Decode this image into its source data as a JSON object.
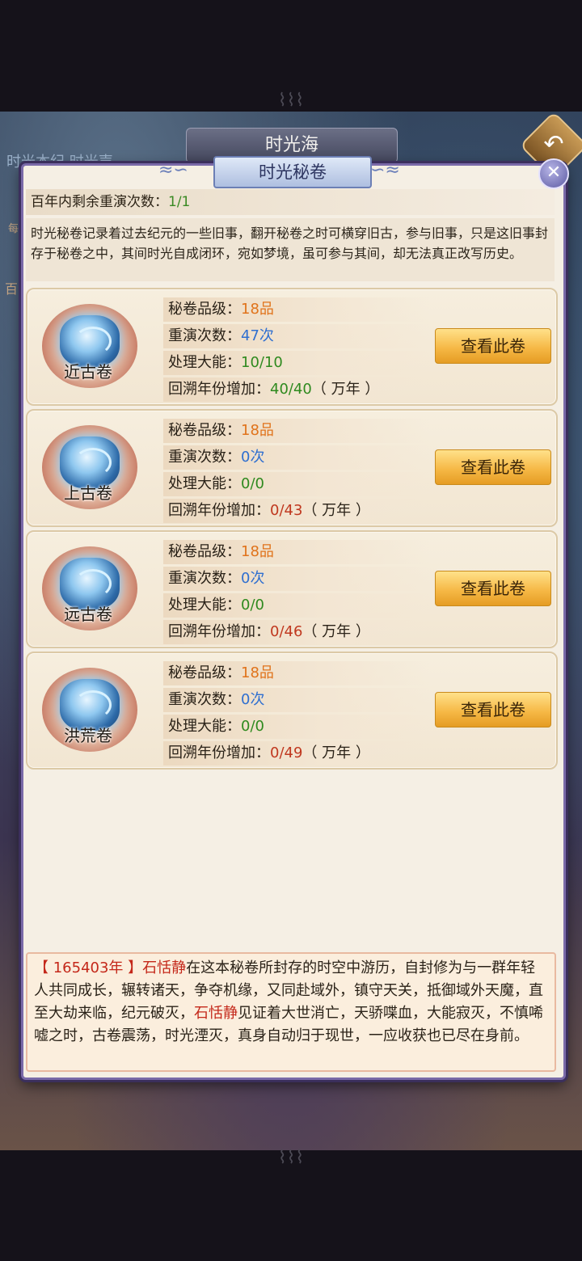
{
  "background": {
    "title": "时光海",
    "tabs": "时光本纪  时光声",
    "side_left_1": "百",
    "side_left_2": "每",
    "back_icon": "back-arrow-icon",
    "ornament_top": "⌇⌇⌇",
    "ornament_bottom": "⌇⌇⌇"
  },
  "modal": {
    "title": "时光秘卷",
    "close_icon": "close-icon",
    "wing_left": "≈∽",
    "wing_right": "∽≈",
    "remain_label": "百年内剩余重演次数：",
    "remain_value": "1/1",
    "intro": "时光秘卷记录着过去纪元的一些旧事，翻开秘卷之时可横穿旧古，参与旧事，只是这旧事封存于秘卷之中，其间时光自成闭环，宛如梦境，虽可参与其间，却无法真正改写历史。"
  },
  "labels": {
    "grade": "秘卷品级：",
    "replays": "重演次数：",
    "handled": "处理大能：",
    "years": "回溯年份增加：",
    "unit": "（ 万年 ）",
    "view_button": "查看此卷"
  },
  "cards": [
    {
      "name": "近古卷",
      "grade": "18品",
      "replays": "47次",
      "handled": "10/10",
      "years": "40/40",
      "years_color": "green"
    },
    {
      "name": "上古卷",
      "grade": "18品",
      "replays": "0次",
      "handled": "0/0",
      "years": "0/43",
      "years_color": "red"
    },
    {
      "name": "远古卷",
      "grade": "18品",
      "replays": "0次",
      "handled": "0/0",
      "years": "0/46",
      "years_color": "red"
    },
    {
      "name": "洪荒卷",
      "grade": "18品",
      "replays": "0次",
      "handled": "0/0",
      "years": "0/49",
      "years_color": "red"
    }
  ],
  "story": {
    "year": "【 165403年 】",
    "name": "石恬静",
    "text1": "在这本秘卷所封存的时空中游历，自封修为与一群年轻人共同成长，辗转诸天，争夺机缘，又同赴域外，镇守天关，抵御域外天魔，直至大劫来临，纪元破灭，",
    "name2": "石恬静",
    "text2": "见证着大世消亡，天骄喋血，大能寂灭，不慎唏嘘之时，古卷震荡，时光湮灭，真身自动归于现世，一应收获也已尽在身前。"
  },
  "colors": {
    "accent_orange": "#e0731b",
    "accent_blue": "#2f6fd0",
    "accent_green": "#2f8a1f",
    "accent_red": "#c0381f",
    "button_gold": "#f6b947"
  }
}
